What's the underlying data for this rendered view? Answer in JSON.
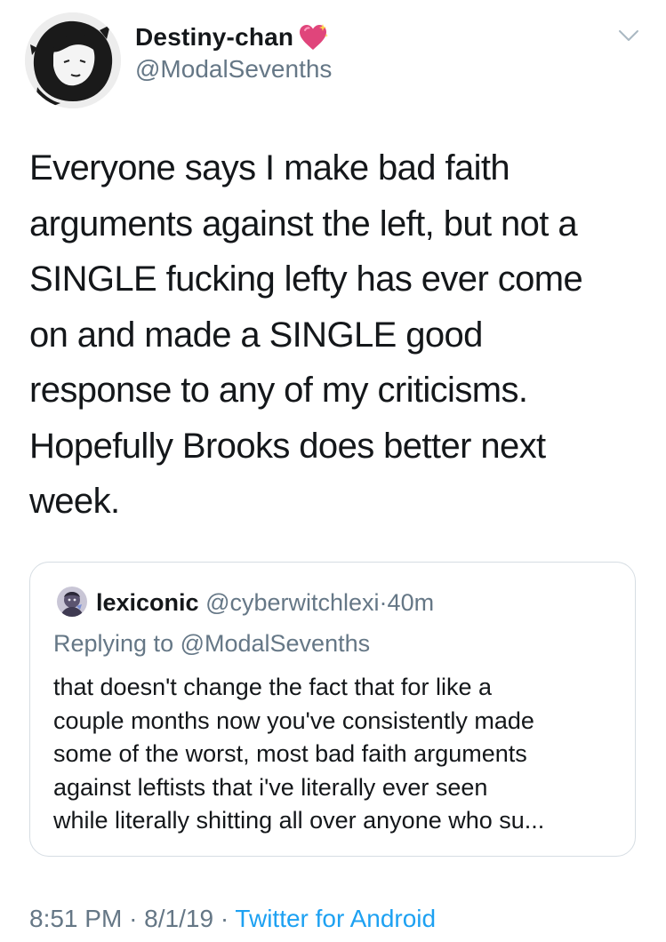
{
  "author": {
    "display_name": "Destiny-chan",
    "handle": "@ModalSevenths",
    "avatar_icon": "avatar-portrait-icon",
    "name_emoji": "sparkling-heart-icon"
  },
  "tweet": {
    "text": "Everyone says I make bad faith\narguments against the left, but not a\nSINGLE fucking lefty has ever come\non and made a SINGLE good\nresponse to any of my criticisms.\nHopefully Brooks does better next\nweek."
  },
  "quoted": {
    "name": "lexiconic",
    "handle": "@cyberwitchlexi",
    "separator": "·",
    "time": "40m",
    "replying_to": "Replying to @ModalSevenths",
    "text": "that doesn't change the fact that for like a\ncouple months now you've consistently made\nsome of the worst, most bad faith arguments\nagainst leftists that i've literally ever seen\nwhile literally shitting all over anyone who su..."
  },
  "meta": {
    "time": "8:51 PM",
    "sep1": "·",
    "date": "8/1/19",
    "sep2": "·",
    "source": "Twitter for Android"
  },
  "colors": {
    "primary_text": "#14171a",
    "secondary_text": "#657786",
    "link": "#1da1f2",
    "border": "#d6dde3",
    "heart": "#e0457b"
  }
}
